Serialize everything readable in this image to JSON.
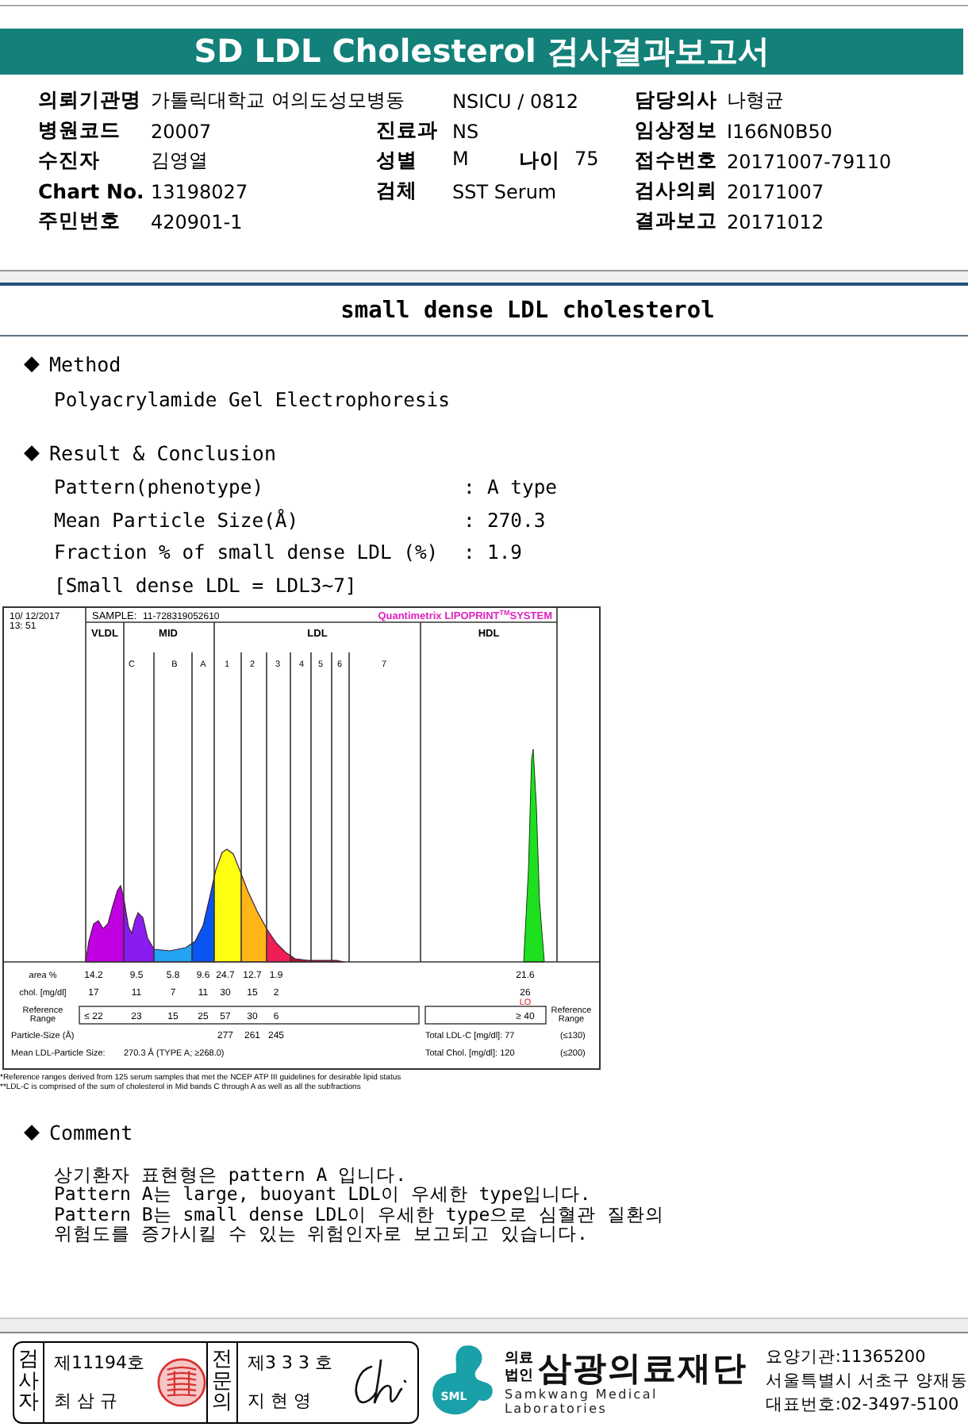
{
  "title": "SD LDL Cholesterol 검사결과보고서",
  "info": {
    "left": [
      {
        "label": "의뢰기관명",
        "value": "가톨릭대학교 여의도성모병동"
      },
      {
        "label": "병원코드",
        "value": "20007"
      },
      {
        "label": "수진자",
        "value": "김영열"
      },
      {
        "label": "Chart No.",
        "value": "13198027"
      },
      {
        "label": "주민번호",
        "value": "420901-1"
      }
    ],
    "middle": [
      {
        "kind": "value",
        "value": "NSICU / 0812"
      },
      {
        "kind": "field",
        "label": "진료과",
        "value": "NS"
      },
      {
        "kind": "pair",
        "label": "성별",
        "value": "M",
        "label_2": "나이",
        "value_2": "75"
      },
      {
        "kind": "field",
        "label": "검체",
        "value": "SST Serum"
      }
    ],
    "right": [
      {
        "label": "담당의사",
        "value": "나형균"
      },
      {
        "label": "임상정보",
        "value": "I166N0B50"
      },
      {
        "label": "접수번호",
        "value": "20171007-79110"
      },
      {
        "label": "검사의뢰",
        "value": "20171007"
      },
      {
        "label": "결과보고",
        "value": "20171012"
      }
    ]
  },
  "section_title": "small dense LDL cholesterol",
  "method": {
    "bullet": "◆",
    "heading": "Method",
    "text": "Polyacrylamide Gel Electrophoresis"
  },
  "result": {
    "bullet": "◆",
    "heading": "Result & Conclusion",
    "rows": [
      {
        "label": "Pattern(phenotype)",
        "separator": ":",
        "value": "A type"
      },
      {
        "label": "Mean Particle Size(Å)",
        "separator": ":",
        "value": "270.3"
      },
      {
        "label": "Fraction % of small dense LDL (%)",
        "separator": ":",
        "value": "1.9"
      }
    ],
    "note": "[Small dense LDL = LDL3~7]"
  },
  "chart": {
    "date": [
      "10/ 12/2017",
      "13: 51"
    ],
    "sample_label": "SAMPLE:",
    "sample_id": "11-728319052610",
    "brand": "Quantimetrix LIPOPRINT",
    "brand_mark": "TM",
    "brand_suffix": "SYSTEM",
    "bands": [
      "VLDL",
      "MID",
      "LDL",
      "HDL"
    ],
    "subbands": [
      "C",
      "B",
      "A",
      "1",
      "2",
      "3",
      "4",
      "5",
      "6",
      "7"
    ],
    "area": {
      "label": "area %",
      "values": [
        "14.2",
        "9.5",
        "5.8",
        "9.6",
        "24.7",
        "12.7",
        "1.9"
      ],
      "hdl": "21.6"
    },
    "chol": {
      "label": "chol. [mg/dl]",
      "values": [
        "17",
        "11",
        "7",
        "11",
        "30",
        "15",
        "2"
      ],
      "hdl": "26",
      "hdl_flag": "LO"
    },
    "reference": {
      "label": [
        "Reference",
        "Range"
      ],
      "values": [
        "≤ 22",
        "23",
        "15",
        "25",
        "57",
        "30",
        "6"
      ],
      "hdl": "≥ 40",
      "right_label": [
        "Reference",
        "Range"
      ]
    },
    "particle": {
      "label": "Particle-Size (Å)",
      "values": [
        "277",
        "261",
        "245"
      ],
      "right": "Total LDL-C [mg/dl]: 77",
      "right_range": "(≤130)"
    },
    "mean": {
      "label": "Mean LDL-Particle Size:",
      "value": "270.3 Å  (TYPE A; ≥268.0)",
      "right": "Total Chol. [mg/dl]:  120",
      "right_range": "(≤200)"
    },
    "footnotes": [
      "*Reference ranges derived from 125 serum samples that met the NCEP ATP III guidelines for desirable lipid status",
      "**LDL-C is comprised of the sum of cholesterol in Mid bands C through A as well as all the subfractions"
    ]
  },
  "comment": {
    "bullet": "◆",
    "heading": "Comment",
    "lines": [
      "상기환자 표현형은 pattern A 입니다.",
      "Pattern A는 large, buoyant LDL이 우세한 type입니다.",
      "Pattern B는 small dense LDL이 우세한 type으로 심혈관 질환의",
      "위험도를 증가시킬 수 있는 위험인자로 보고되고 있습니다."
    ]
  },
  "footer": {
    "signers": [
      {
        "role": "검사자",
        "license": "제11194호",
        "name": "최 삼 규"
      },
      {
        "role": "전문의",
        "license": "제3 3 3 호",
        "name": "지 현 영"
      }
    ],
    "logo": {
      "mark": "SML",
      "corp": [
        "의료",
        "법인"
      ],
      "name": "삼광의료재단",
      "english": "Samkwang Medical Laboratories"
    },
    "contact": [
      "요양기관:11365200",
      "서울특별시 서초구 양재동",
      "대표번호:02-3497-5100"
    ]
  }
}
